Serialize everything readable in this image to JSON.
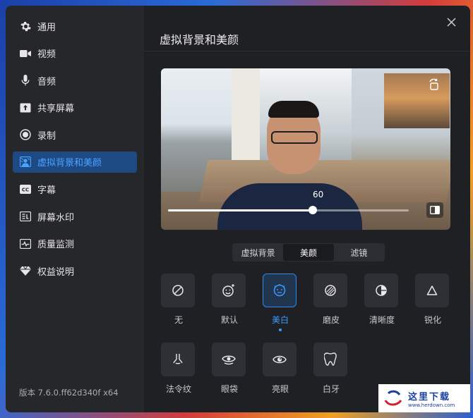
{
  "sidebar": {
    "items": [
      {
        "label": "通用",
        "icon": "gear-icon"
      },
      {
        "label": "视频",
        "icon": "camera-icon"
      },
      {
        "label": "音频",
        "icon": "microphone-icon"
      },
      {
        "label": "共享屏幕",
        "icon": "share-screen-icon"
      },
      {
        "label": "录制",
        "icon": "record-icon"
      },
      {
        "label": "虚拟背景和美颜",
        "icon": "virtual-background-icon",
        "active": true
      },
      {
        "label": "字幕",
        "icon": "caption-icon"
      },
      {
        "label": "屏幕水印",
        "icon": "watermark-icon"
      },
      {
        "label": "质量监测",
        "icon": "pulse-icon"
      },
      {
        "label": "权益说明",
        "icon": "diamond-icon"
      }
    ],
    "version": "版本 7.6.0.ff62d340f x64"
  },
  "main": {
    "title": "虚拟背景和美颜",
    "slider": {
      "value": "60",
      "fraction": 0.6
    },
    "tabs": [
      {
        "label": "虚拟背景"
      },
      {
        "label": "美颜",
        "active": true
      },
      {
        "label": "滤镜"
      }
    ],
    "effects": [
      {
        "label": "无",
        "icon": "none-icon"
      },
      {
        "label": "默认",
        "icon": "smile-sparkle-icon"
      },
      {
        "label": "美白",
        "icon": "whitening-icon",
        "active": true
      },
      {
        "label": "磨皮",
        "icon": "smooth-skin-icon"
      },
      {
        "label": "清晰度",
        "icon": "clarity-icon"
      },
      {
        "label": "锐化",
        "icon": "sharpen-icon"
      },
      {
        "label": "法令纹",
        "icon": "nasolabial-icon"
      },
      {
        "label": "眼袋",
        "icon": "eye-bag-icon"
      },
      {
        "label": "亮眼",
        "icon": "bright-eye-icon"
      },
      {
        "label": "白牙",
        "icon": "tooth-icon"
      }
    ]
  },
  "watermark": {
    "text": "这里下载",
    "url": "www.herdown.com"
  },
  "colors": {
    "accent": "#2d8cf0",
    "active_nav_bg": "#1e4a84",
    "background": "#1f2024"
  }
}
